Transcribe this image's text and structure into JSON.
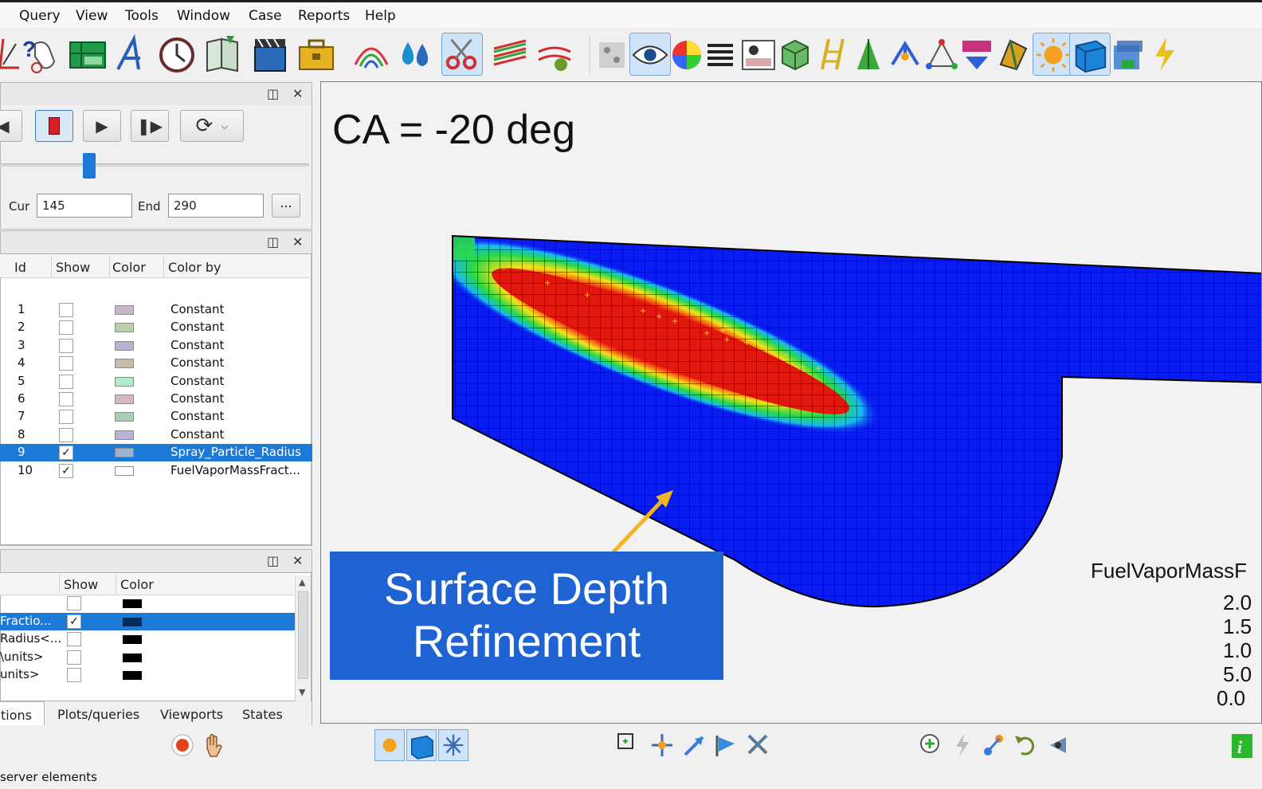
{
  "menu": {
    "items": [
      "Query",
      "View",
      "Tools",
      "Window",
      "Case",
      "Reports",
      "Help"
    ]
  },
  "toolbar": {
    "icons": [
      "pick-icon",
      "query-icon",
      "spreadsheet-icon",
      "annotation-icon",
      "clock-icon",
      "book-icon",
      "movie-icon",
      "toolbox-icon",
      "contour-icon",
      "drops-icon",
      "scissors-icon",
      "lines-icon",
      "streamline-icon",
      "noise-icon",
      "eye-icon",
      "color-wheel-icon",
      "lines-list-icon",
      "camera-icon",
      "cube-grid-icon",
      "ladder-icon",
      "tree-icon",
      "graph-icon",
      "triangle-icon",
      "mesh-icon",
      "flag-icon",
      "sun-icon",
      "box-icon",
      "slab-icon",
      "lightning-icon"
    ]
  },
  "animation": {
    "cur_label": "Cur",
    "cur_value": "145",
    "end_label": "End",
    "end_value": "290",
    "more_label": "...",
    "slider_fraction": 0.5
  },
  "parts": {
    "columns": {
      "id": "Id",
      "show": "Show",
      "color": "Color",
      "color_by": "Color by"
    },
    "rows": [
      {
        "id": "1",
        "checked": false,
        "color": "#c9b4c9",
        "color_by": "Constant"
      },
      {
        "id": "2",
        "checked": false,
        "color": "#b8d1ae",
        "color_by": "Constant"
      },
      {
        "id": "3",
        "checked": false,
        "color": "#b5b1d0",
        "color_by": "Constant"
      },
      {
        "id": "4",
        "checked": false,
        "color": "#c8bca9",
        "color_by": "Constant"
      },
      {
        "id": "5",
        "checked": false,
        "color": "#aeedc9",
        "color_by": "Constant"
      },
      {
        "id": "6",
        "checked": false,
        "color": "#d3b7c2",
        "color_by": "Constant"
      },
      {
        "id": "7",
        "checked": false,
        "color": "#a9cfb1",
        "color_by": "Constant"
      },
      {
        "id": "8",
        "checked": false,
        "color": "#b8b2d8",
        "color_by": "Constant"
      },
      {
        "id": "9",
        "checked": true,
        "color": "#9bb3cf",
        "color_by": "Spray_Particle_Radius",
        "selected": true
      },
      {
        "id": "10",
        "checked": true,
        "color": "#ffffff",
        "color_by": "FuelVaporMassFract..."
      }
    ]
  },
  "variables": {
    "columns": {
      "show": "Show",
      "color": "Color"
    },
    "rows": [
      {
        "name": "",
        "checked": false
      },
      {
        "name": "Fractio...",
        "checked": true,
        "selected": true
      },
      {
        "name": "Radius<...",
        "checked": false
      },
      {
        "name": "\\units>",
        "checked": false
      },
      {
        "name": "units>",
        "checked": false
      }
    ]
  },
  "tabs": [
    "tions",
    "Plots/queries",
    "Viewports",
    "States"
  ],
  "viewport": {
    "ca_label": "CA = -20 deg",
    "callout_line1": "Surface Depth",
    "callout_line2": "Refinement",
    "legend_title": "FuelVaporMassF",
    "legend_ticks": [
      "2.0",
      "1.5",
      "1.0",
      "5.0",
      "0.0"
    ],
    "callout_color": "#1f63d2",
    "arrow_color": "#f2b526"
  },
  "status": {
    "text": " server elements"
  }
}
